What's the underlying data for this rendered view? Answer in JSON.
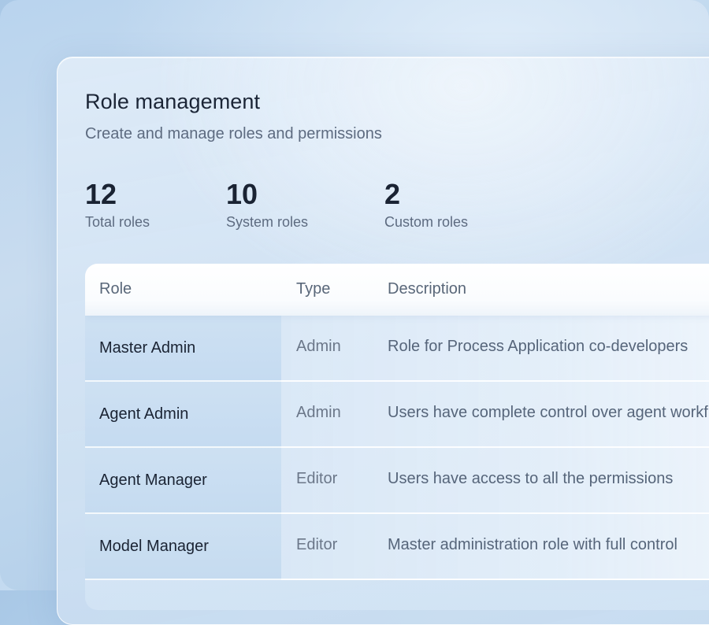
{
  "header": {
    "title": "Role management",
    "subtitle": "Create and manage roles and permissions"
  },
  "stats": [
    {
      "value": "12",
      "label": "Total roles"
    },
    {
      "value": "10",
      "label": "System roles"
    },
    {
      "value": "2",
      "label": "Custom roles"
    }
  ],
  "table": {
    "columns": [
      "Role",
      "Type",
      "Description"
    ],
    "rows": [
      {
        "role": "Master Admin",
        "type": "Admin",
        "description": "Role for Process Application co-developers"
      },
      {
        "role": "Agent Admin",
        "type": "Admin",
        "description": "Users have complete control over agent workflows"
      },
      {
        "role": "Agent Manager",
        "type": "Editor",
        "description": "Users have access to all the permissions"
      },
      {
        "role": "Model Manager",
        "type": "Editor",
        "description": "Master administration role with full control"
      }
    ]
  }
}
